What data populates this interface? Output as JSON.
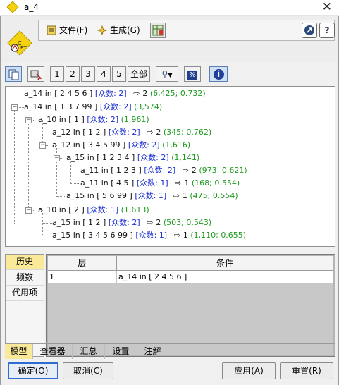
{
  "window": {
    "title": "a_4",
    "close_glyph": "✕"
  },
  "menu": {
    "file": "文件(F)",
    "generate": "生成(G)"
  },
  "toolbar": {
    "levels": [
      "1",
      "2",
      "3",
      "4",
      "5"
    ],
    "all": "全部",
    "percent_glyph": "%",
    "info_glyph": "i",
    "key_glyph": "⚲"
  },
  "help": {
    "question": "?"
  },
  "tree": [
    {
      "label": "a_14 in [ 2 4 5 6 ]",
      "mode": "[众数: 2]",
      "pred": "2",
      "stats": "(6,425; 0.732)"
    },
    {
      "label": "a_14 in [ 1 3 7 99 ]",
      "mode": "[众数: 2]",
      "pred": "",
      "stats": "(3,574)"
    },
    {
      "label": "a_10 in [ 1 ]",
      "mode": "[众数: 2]",
      "pred": "",
      "stats": "(1,961)"
    },
    {
      "label": "a_12 in [ 1 2 ]",
      "mode": "[众数: 2]",
      "pred": "2",
      "stats": "(345; 0.762)"
    },
    {
      "label": "a_12 in [ 3 4 5 99 ]",
      "mode": "[众数: 2]",
      "pred": "",
      "stats": "(1,616)"
    },
    {
      "label": "a_15 in [ 1 2 3 4 ]",
      "mode": "[众数: 2]",
      "pred": "",
      "stats": "(1,141)"
    },
    {
      "label": "a_11 in [ 1 2 3 ]",
      "mode": "[众数: 2]",
      "pred": "2",
      "stats": "(973; 0.621)"
    },
    {
      "label": "a_11 in [ 4 5 ]",
      "mode": "[众数: 1]",
      "pred": "1",
      "stats": "(168; 0.554)"
    },
    {
      "label": "a_15 in [ 5 6 99 ]",
      "mode": "[众数: 1]",
      "pred": "1",
      "stats": "(475; 0.554)"
    },
    {
      "label": "a_10 in [ 2 ]",
      "mode": "[众数: 1]",
      "pred": "",
      "stats": "(1,613)"
    },
    {
      "label": "a_15 in [ 1 2 ]",
      "mode": "[众数: 2]",
      "pred": "2",
      "stats": "(503; 0.543)"
    },
    {
      "label": "a_15 in [ 3 4 5 6 99 ]",
      "mode": "[众数: 1]",
      "pred": "1",
      "stats": "(1,110; 0.655)"
    }
  ],
  "side_tabs": [
    "历史",
    "频数",
    "代用项"
  ],
  "grid": {
    "headers": [
      "层",
      "条件"
    ],
    "rows": [
      [
        "1",
        "a_14 in [ 2 4 5 6 ]"
      ]
    ]
  },
  "bottom_tabs": [
    "模型",
    "查看器",
    "汇总",
    "设置",
    "注解"
  ],
  "buttons": {
    "ok": "确定(O)",
    "cancel": "取消(C)",
    "apply": "应用(A)",
    "reset": "重置(R)"
  },
  "colors": {
    "mode": "#1a2fd0",
    "stats": "#1e9a1e",
    "active_tab": "#fbe99a"
  }
}
